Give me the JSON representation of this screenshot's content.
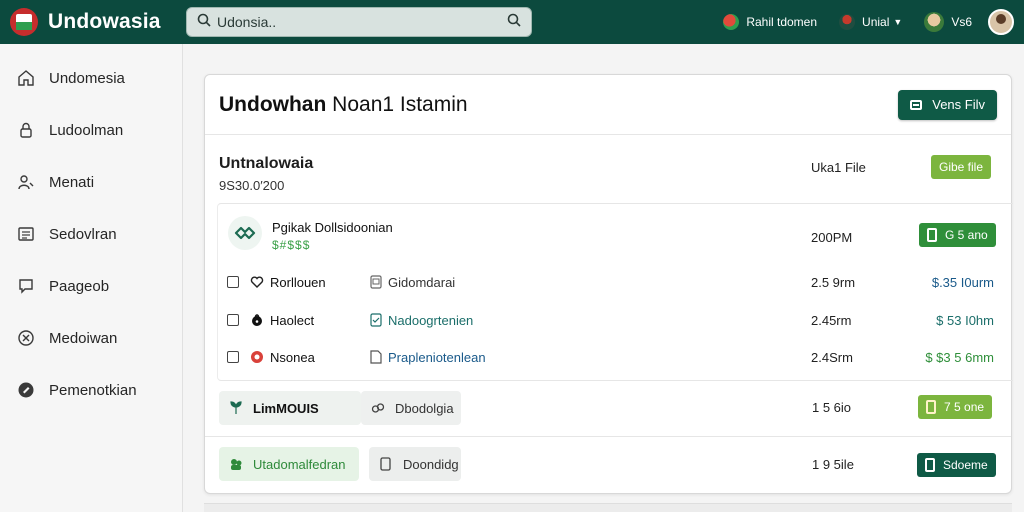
{
  "app": {
    "name": "Undowasia",
    "brand_color": "#0c4a3e"
  },
  "search": {
    "value": "Udonsia..",
    "icon_left": "search-icon",
    "icon_right": "search-icon"
  },
  "top_actions": [
    {
      "label": "Rahil tdomen"
    },
    {
      "label": "Unial",
      "has_dropdown": true
    },
    {
      "label": "Vs6"
    }
  ],
  "sidebar": {
    "items": [
      {
        "label": "Undomesia",
        "icon": "home-icon"
      },
      {
        "label": "Ludoolman",
        "icon": "lock-icon"
      },
      {
        "label": "Menati",
        "icon": "user-icon"
      },
      {
        "label": "Sedovlran",
        "icon": "list-icon"
      },
      {
        "label": "Paageob",
        "icon": "chat-icon"
      },
      {
        "label": "Medoiwan",
        "icon": "close-circle-icon"
      },
      {
        "label": "Pemenotkian",
        "icon": "settings-circle-icon"
      }
    ]
  },
  "card": {
    "title_bold": "Undowhan",
    "title_light": "Noan1 Istamin",
    "primary_button": "Vens Filv",
    "summary": {
      "title": "Untnalowaia",
      "value": "9S30.0′200",
      "file": "Uka1 File",
      "action": "Gibe file"
    },
    "feature": {
      "name": "Pgikak Dollsidoonian",
      "sub": "$#$$$",
      "time": "200PM",
      "action": "G 5 ano"
    },
    "rows": [
      {
        "name": "Rorllouen",
        "desc": "Gidomdarai",
        "time": "2.5 9rm",
        "price": "$.35 I0urm",
        "checked": false
      },
      {
        "name": "Haolect",
        "desc": "Nadoogrtenien",
        "time": "2.45rm",
        "price": "$ 53 I0hm",
        "checked": false
      },
      {
        "name": "Nsonea",
        "desc": "Prapleniotenlean",
        "time": "2.4Srm",
        "price": "$ $3 5 6mm",
        "checked": false
      }
    ],
    "footer_rows": [
      {
        "chip_a": "LimMOUIS",
        "chip_b": "Dbodolgia",
        "time": "1 5 6io",
        "action": "7 5 one"
      },
      {
        "chip_a": "Utadomalfedran",
        "chip_b": "Doondidg",
        "time": "1 9 5ile",
        "action": "Sdoeme"
      }
    ]
  },
  "colors": {
    "primary": "#0f5a46",
    "accent_lime": "#7cb53e",
    "accent_green": "#2f8f3a",
    "link_blue": "#1a5a8a",
    "link_teal": "#1b6e6a",
    "link_green": "#2e8a3a"
  }
}
